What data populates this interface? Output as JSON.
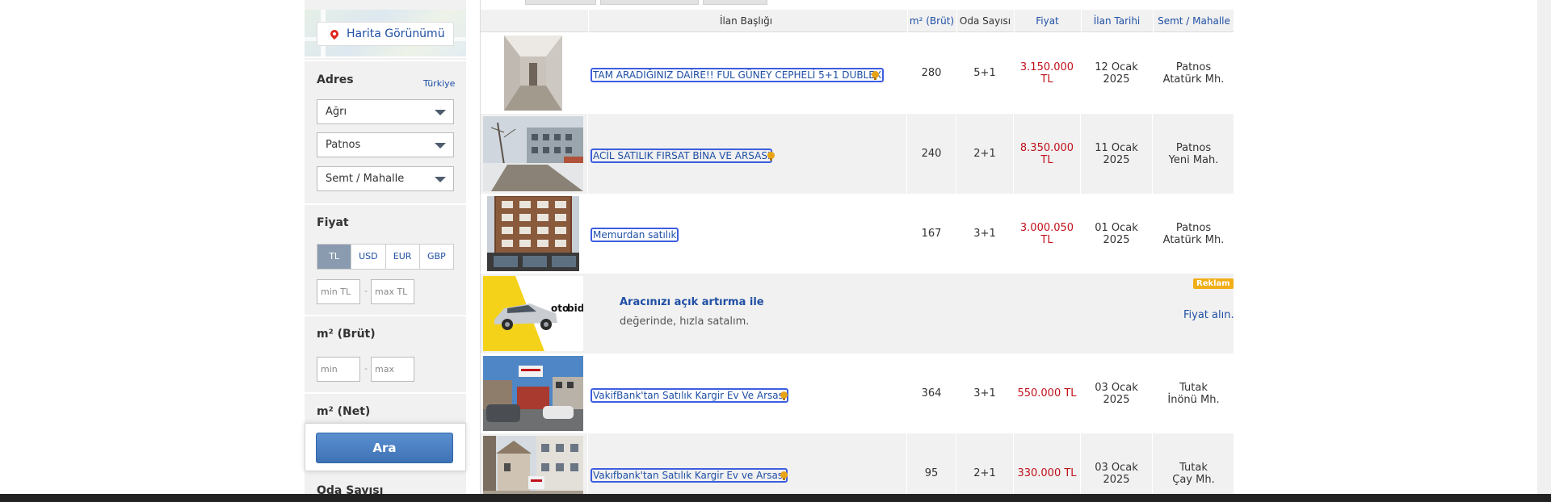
{
  "sidebar": {
    "map_button": "Harita Görünümü",
    "address": {
      "title": "Adres",
      "country_link": "Türkiye",
      "province": "Ağrı",
      "district": "Patnos",
      "neighborhood": "Semt / Mahalle"
    },
    "price": {
      "title": "Fiyat",
      "currencies": [
        "TL",
        "USD",
        "EUR",
        "GBP"
      ],
      "active_currency": "TL",
      "min_placeholder": "min TL",
      "max_placeholder": "max TL",
      "separator": "-"
    },
    "gross_area": {
      "title": "m² (Brüt)",
      "min_placeholder": "min",
      "max_placeholder": "max",
      "separator": "-"
    },
    "net_area": {
      "title": "m² (Net)"
    },
    "rooms": {
      "title": "Oda Sayısı"
    },
    "search_button": "Ara"
  },
  "table": {
    "headers": {
      "title": "İlan Başlığı",
      "area": "m² (Brüt)",
      "rooms": "Oda Sayısı",
      "price": "Fiyat",
      "date": "İlan Tarihi",
      "location": "Semt / Mahalle"
    },
    "rows": [
      {
        "title": "TAM ARADIĞINIZ DAİRE!! FUL GÜNEY CEPHELİ 5+1 DUBLEX",
        "area": "280",
        "rooms": "5+1",
        "price": "3.150.000 TL",
        "date_day": "12 Ocak",
        "date_year": "2025",
        "city": "Patnos",
        "neighborhood": "Atatürk Mh.",
        "thumb": "hallway"
      },
      {
        "title": "ACİL SATILIK FIRSAT BİNA VE ARSASI",
        "area": "240",
        "rooms": "2+1",
        "price": "8.350.000 TL",
        "date_day": "11 Ocak",
        "date_year": "2025",
        "city": "Patnos",
        "neighborhood": "Yeni Mah.",
        "thumb": "street"
      },
      {
        "title": "Memurdan satılık",
        "area": "167",
        "rooms": "3+1",
        "price": "3.000.050 TL",
        "date_day": "01 Ocak",
        "date_year": "2025",
        "city": "Patnos",
        "neighborhood": "Atatürk Mh.",
        "thumb": "building"
      },
      {
        "title": "VakifBank'tan Satılık Kargir Ev Ve Arsası",
        "area": "364",
        "rooms": "3+1",
        "price": "550.000 TL",
        "date_day": "03 Ocak",
        "date_year": "2025",
        "city": "Tutak",
        "neighborhood": "İnönü Mh.",
        "thumb": "lot"
      },
      {
        "title": "Vakıfbank'tan Satılık Kargir Ev ve Arsası",
        "area": "95",
        "rooms": "2+1",
        "price": "330.000 TL",
        "date_day": "03 Ocak",
        "date_year": "2025",
        "city": "Tutak",
        "neighborhood": "Çay Mh.",
        "thumb": "house"
      }
    ],
    "ad": {
      "title": "Aracınızı açık artırma ile",
      "subtitle": "değerinde, hızla satalım.",
      "badge": "Reklam",
      "cta": "Fiyat alın.",
      "logo_text": "otobid"
    }
  },
  "colors": {
    "link_blue": "#1f4fa5",
    "price_red": "#c0121b",
    "ad_badge": "#f1ae16",
    "button_blue": "#3e72b6"
  }
}
